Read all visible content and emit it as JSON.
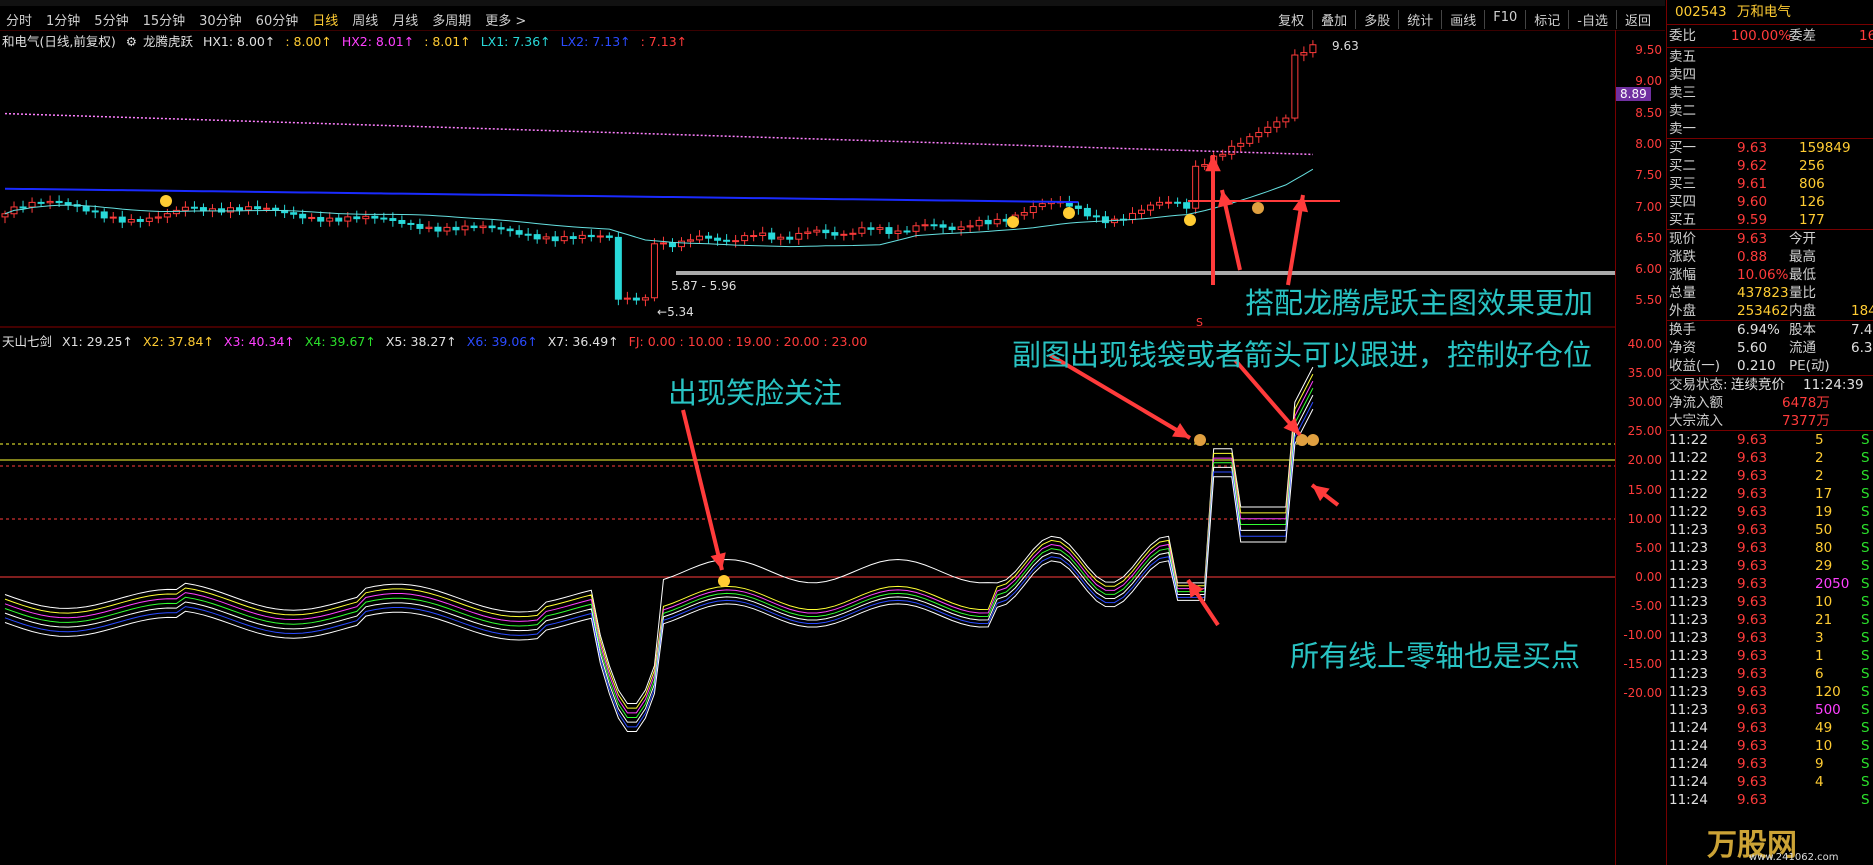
{
  "toolbar": {
    "periods": [
      "分时",
      "1分钟",
      "5分钟",
      "15分钟",
      "30分钟",
      "60分钟",
      "日线",
      "周线",
      "月线",
      "多周期",
      "更多 >"
    ],
    "active_period": "日线",
    "tools": [
      "复权",
      "叠加",
      "多股",
      "统计",
      "画线",
      "F10",
      "标记",
      "-自选",
      "返回"
    ]
  },
  "main_legend": {
    "stock": "和电气(日线,前复权)",
    "indicator": "龙腾虎跃",
    "hx1": "HX1: 8.00↑",
    "v2": ": 8.00↑",
    "hx2": "HX2: 8.01↑",
    "v3": ": 8.01↑",
    "lx1": "LX1: 7.36↑",
    "lx2": "LX2: 7.13↑",
    "v4": ": 7.13↑"
  },
  "sub_legend": {
    "name": "天山七剑",
    "x1": "X1: 29.25↑",
    "x2": "X2: 37.84↑",
    "x3": "X3: 40.34↑",
    "x4": "X4: 39.67↑",
    "x5": "X5: 38.27↑",
    "x6": "X6: 39.06↑",
    "x7": "X7: 36.49↑",
    "fj": "FJ: 0.00 : 10.00 : 19.00 : 20.00 : 23.00"
  },
  "main_axis": [
    "9.50",
    "9.00",
    "8.50",
    "8.00",
    "7.50",
    "7.00",
    "6.50",
    "6.00",
    "5.50"
  ],
  "sub_axis": [
    "40.00",
    "35.00",
    "30.00",
    "25.00",
    "20.00",
    "15.00",
    "10.00",
    "5.00",
    "0.00",
    "-5.00",
    "-10.00",
    "-15.00",
    "-20.00"
  ],
  "price_marker": "8.89",
  "chart_labels": {
    "high": "9.63",
    "low": "5.34",
    "range": "5.87 - 5.96",
    "s_mark": "S"
  },
  "annotations": {
    "main_right": "搭配龙腾虎跃主图效果更加",
    "sub_top": "副图出现钱袋或者箭头可以跟进，控制好仓位",
    "smile": "出现笑脸关注",
    "zero": "所有线上零轴也是买点"
  },
  "panel": {
    "code": "002543",
    "name": "万和电气",
    "weibi_label": "委比",
    "weibi": "100.00%",
    "weicha_label": "委差",
    "weicha": "16",
    "sells": [
      "卖五",
      "卖四",
      "卖三",
      "卖二",
      "卖一"
    ],
    "buys": [
      {
        "label": "买一",
        "price": "9.63",
        "vol": "159849"
      },
      {
        "label": "买二",
        "price": "9.62",
        "vol": "256"
      },
      {
        "label": "买三",
        "price": "9.61",
        "vol": "806"
      },
      {
        "label": "买四",
        "price": "9.60",
        "vol": "126"
      },
      {
        "label": "买五",
        "price": "9.59",
        "vol": "177"
      }
    ],
    "quote": [
      {
        "l": "现价",
        "v": "9.63",
        "l2": "今开",
        "v2": ""
      },
      {
        "l": "涨跌",
        "v": "0.88",
        "l2": "最高",
        "v2": ""
      },
      {
        "l": "涨幅",
        "v": "10.06%",
        "l2": "最低",
        "v2": ""
      },
      {
        "l": "总量",
        "v": "437823",
        "l2": "量比",
        "v2": ""
      },
      {
        "l": "外盘",
        "v": "253462",
        "l2": "内盘",
        "v2": "184"
      }
    ],
    "fin": [
      {
        "l": "换手",
        "v": "6.94%",
        "l2": "股本",
        "v2": "7.4"
      },
      {
        "l": "净资",
        "v": "5.60",
        "l2": "流通",
        "v2": "6.3"
      },
      {
        "l": "收益(一)",
        "v": "0.210",
        "l2": "PE(动)",
        "v2": ""
      }
    ],
    "status_label": "交易状态:",
    "status": "连续竞价",
    "status_time": "11:24:39",
    "inflow_label": "净流入额",
    "inflow": "6478万",
    "block_label": "大宗流入",
    "block": "7377万",
    "ticks": [
      {
        "t": "11:22",
        "p": "9.63",
        "v": "5",
        "s": "S"
      },
      {
        "t": "11:22",
        "p": "9.63",
        "v": "2",
        "s": "S"
      },
      {
        "t": "11:22",
        "p": "9.63",
        "v": "2",
        "s": "S"
      },
      {
        "t": "11:22",
        "p": "9.63",
        "v": "17",
        "s": "S"
      },
      {
        "t": "11:22",
        "p": "9.63",
        "v": "19",
        "s": "S"
      },
      {
        "t": "11:23",
        "p": "9.63",
        "v": "50",
        "s": "S"
      },
      {
        "t": "11:23",
        "p": "9.63",
        "v": "80",
        "s": "S"
      },
      {
        "t": "11:23",
        "p": "9.63",
        "v": "29",
        "s": "S"
      },
      {
        "t": "11:23",
        "p": "9.63",
        "v": "2050",
        "s": "S"
      },
      {
        "t": "11:23",
        "p": "9.63",
        "v": "10",
        "s": "S"
      },
      {
        "t": "11:23",
        "p": "9.63",
        "v": "21",
        "s": "S"
      },
      {
        "t": "11:23",
        "p": "9.63",
        "v": "3",
        "s": "S"
      },
      {
        "t": "11:23",
        "p": "9.63",
        "v": "1",
        "s": "S"
      },
      {
        "t": "11:23",
        "p": "9.63",
        "v": "6",
        "s": "S"
      },
      {
        "t": "11:23",
        "p": "9.63",
        "v": "120",
        "s": "S"
      },
      {
        "t": "11:23",
        "p": "9.63",
        "v": "500",
        "s": "S"
      },
      {
        "t": "11:24",
        "p": "9.63",
        "v": "49",
        "s": "S"
      },
      {
        "t": "11:24",
        "p": "9.63",
        "v": "10",
        "s": "S"
      },
      {
        "t": "11:24",
        "p": "9.63",
        "v": "9",
        "s": "S"
      },
      {
        "t": "11:24",
        "p": "9.63",
        "v": "4",
        "s": "S"
      },
      {
        "t": "11:24",
        "p": "9.63",
        "v": "",
        "s": "S"
      }
    ],
    "watermark": "万股网",
    "watermark_url": "www.241062.com"
  },
  "colors": {
    "up": "#ff3b3b",
    "down": "#29d9d9",
    "accent": "#ffcc33",
    "annotation": "#29c3c3",
    "arrow": "#ff3b3b"
  }
}
